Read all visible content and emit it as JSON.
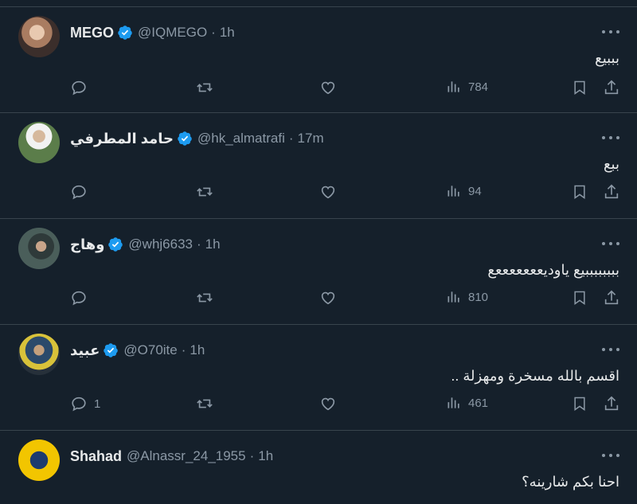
{
  "tweets": [
    {
      "name": "MEGO",
      "handle": "@IQMEGO",
      "sep": "·",
      "time": "1h",
      "text": "بببيع",
      "replies": "",
      "views": "784"
    },
    {
      "name": "حامد المطرفي",
      "handle": "@hk_almatrafi",
      "sep": "·",
      "time": "17m",
      "text": "ببع",
      "replies": "",
      "views": "94"
    },
    {
      "name": "وهاج",
      "handle": "@whj6633",
      "sep": "·",
      "time": "1h",
      "text": "ببببببببيع ياوديعععععععع",
      "replies": "",
      "views": "810"
    },
    {
      "name": "عبيد",
      "handle": "@O70ite",
      "sep": "·",
      "time": "1h",
      "text": "اقسم بالله مسخرة ومهزلة ..",
      "replies": "1",
      "views": "461"
    },
    {
      "name": "Shahad",
      "handle": "@Alnassr_24_1955",
      "sep": "·",
      "time": "1h",
      "text": "احنا بكم شارينه؟",
      "replies": "",
      "views": ""
    }
  ],
  "colors": {
    "background": "#15202b",
    "border": "#38444d",
    "text": "#e7e9ea",
    "muted": "#8b98a5",
    "verified": "#1d9bf0"
  }
}
